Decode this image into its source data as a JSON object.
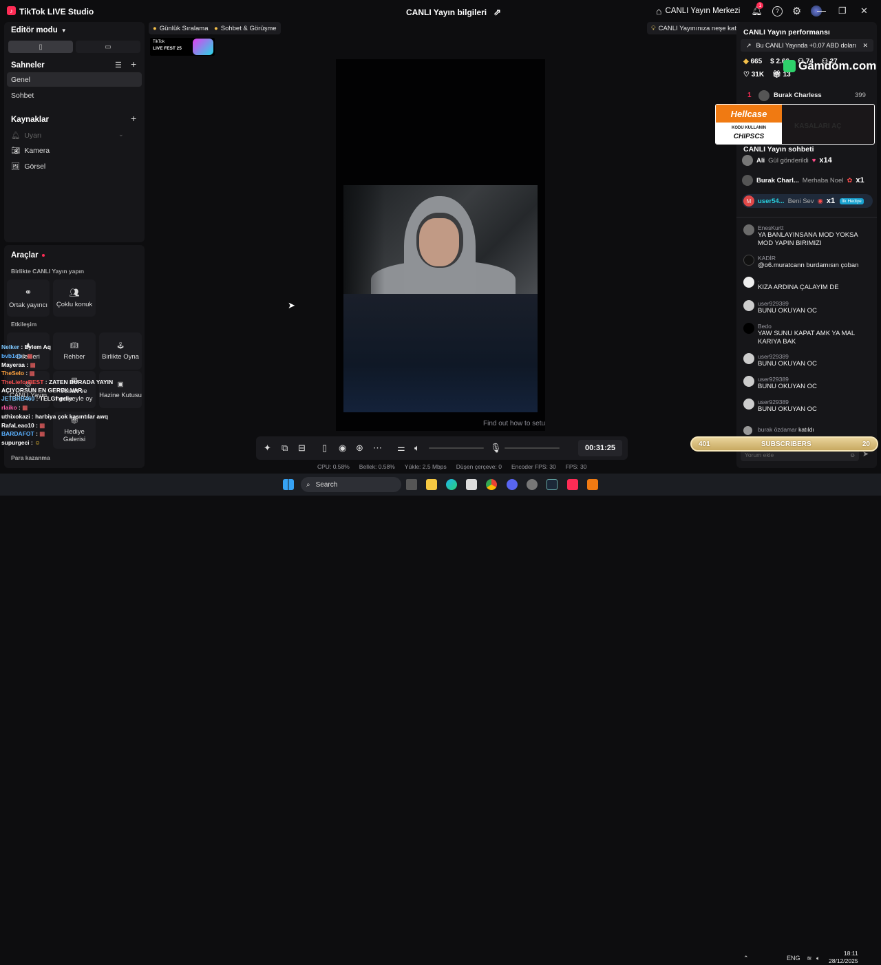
{
  "app": {
    "title": "TikTok LIVE Studio",
    "window_title": "CANLI Yayın bilgileri"
  },
  "topbar": {
    "live_center": "CANLI Yayın Merkezi",
    "notif_count": "1"
  },
  "editor": {
    "mode_label": "Editör modu"
  },
  "scenes": {
    "title": "Sahneler",
    "items": [
      "Genel",
      "Sohbet"
    ]
  },
  "sources": {
    "title": "Kaynaklar",
    "items": [
      "Uyarı",
      "Kamera",
      "Görsel"
    ]
  },
  "tools": {
    "title": "Araçlar",
    "collab_title": "Birlikte CANLI Yayın yapın",
    "collab_items": [
      "Ortak yayıncı",
      "Çoklu konuk"
    ],
    "interaction_title": "Etkileşim",
    "interaction_items": [
      "Dilekleri",
      "Rehber",
      "Birlikte Oyna",
      "CANLI Yayın",
      "Anket ve hediyeyle oy",
      "Hazine Kutusu",
      "Hediye Galerisi"
    ],
    "monetize_title": "Para kazanma"
  },
  "overlay_chat": [
    {
      "name": "Nelker",
      "text": "Eylem Aq",
      "color": "#7ec8ff"
    },
    {
      "name": "bvb1cb",
      "text": "",
      "color": "#5ab0ff"
    },
    {
      "name": "Mayeraa",
      "text": "",
      "color": "#ffffff"
    },
    {
      "name": "TheSelo",
      "text": "",
      "color": "#ffa23d"
    },
    {
      "name": "TheLieforBEST",
      "text": "ZATEN BURADA YAYIN AÇIYORSUN EN GEREK VAR",
      "color": "#ff5151"
    },
    {
      "name": "JETBRB460",
      "text": "TELGf gelio",
      "color": "#7ec8ff"
    },
    {
      "name": "rlaiko",
      "text": "",
      "color": "#ff5aa8"
    },
    {
      "name": "uthixokazi",
      "text": "harbiya çok kasıntılar awq",
      "color": "#ffffff"
    },
    {
      "name": "RafaLeao10",
      "text": "",
      "color": "#ffffff"
    },
    {
      "name": "BARDAFOT",
      "text": "",
      "color": "#5ab0ff"
    },
    {
      "name": "supurgeci",
      "text": "",
      "color": "#ffffff"
    }
  ],
  "pills": [
    "Günlük Sıralama",
    "Sohbet & Görüşme",
    "CANLI Yayınınıza neşe katın"
  ],
  "fest": {
    "label1": "TikTok",
    "label2": "LIVE FEST 25"
  },
  "canvas": {
    "hint": "Find out how to setu"
  },
  "controls": {
    "timer": "00:31:25"
  },
  "stats": [
    {
      "label": "CPU:",
      "value": "0.58%"
    },
    {
      "label": "Bellek:",
      "value": "0.58%"
    },
    {
      "label": "Yükle:",
      "value": "2.5 Mbps"
    },
    {
      "label": "Düşen çerçeve:",
      "value": "0"
    },
    {
      "label": "Encoder FPS:",
      "value": "30"
    },
    {
      "label": "FPS:",
      "value": "30"
    }
  ],
  "performance": {
    "title": "CANLI Yayın performansı",
    "earn_text": "Bu CANLI Yayında +0.07 ABD doları",
    "diamonds": "665",
    "coins": "2.66",
    "viewers_a": "74",
    "viewers_b": "27",
    "likes": "31K",
    "gifts": "13"
  },
  "ads": {
    "gamdom": "Gamdom.com",
    "hellcase": "Hellcase",
    "code_label": "KODU KULLANIN",
    "code": "CHIPSCS",
    "cta": "KASALARI AÇ"
  },
  "ranking": {
    "rank": "1",
    "name": "Burak Charless",
    "score": "399"
  },
  "live_chat": {
    "title": "CANLI Yayın sohbeti",
    "gifts": [
      {
        "name": "Ali",
        "text": "Gül gönderildi",
        "count": "x14"
      },
      {
        "name": "Burak Charl...",
        "text": "Merhaba Noel",
        "count": "x1"
      },
      {
        "name": "user54...",
        "text": "Beni Sev",
        "count": "x1",
        "badge": "İlk Hediye"
      }
    ],
    "messages": [
      {
        "user": "EnesKurtt",
        "text": "YA BANLAYINSANA MOD YOKSA MOD YAPIN BIRIMIZI"
      },
      {
        "user": "KADİR",
        "text": "@o6.muratcann burdamısın çoban"
      },
      {
        "user": ".",
        "text": "KIZA ARDINA ÇALAYIM DE"
      },
      {
        "user": "user929389",
        "text": "BUNU OKUYAN OC"
      },
      {
        "user": "Bedo",
        "text": "YAW SUNU KAPAT AMK YA MAL KARIYA BAK"
      },
      {
        "user": "user929389",
        "text": "BUNU OKUYAN OC"
      },
      {
        "user": "user929389",
        "text": "BUNU OKUYAN OC"
      },
      {
        "user": "user929389",
        "text": "BUNU OKUYAN OC"
      }
    ],
    "join": {
      "user": "burak özdamar",
      "text": "katıldı"
    },
    "input_placeholder": "Yorum ekle"
  },
  "subs_bar": {
    "left": "401",
    "label": "SUBSCRIBERS",
    "right": "20"
  },
  "taskbar": {
    "search": "Search",
    "lang": "ENG",
    "time": "18:11",
    "date": "28/12/2025"
  }
}
